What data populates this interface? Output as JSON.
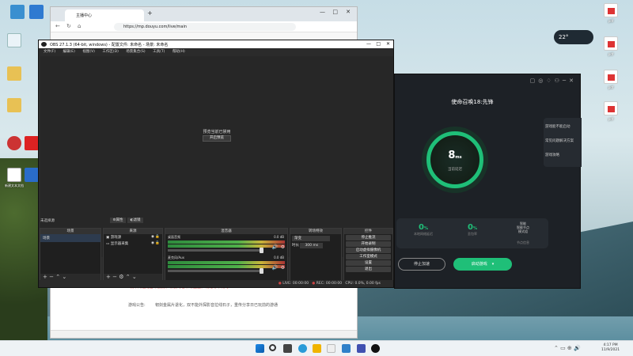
{
  "weather": {
    "temp": "22",
    "unit": "°"
  },
  "browser": {
    "tab_title": "主播中心",
    "url": "https://mp.douyu.com/live/main",
    "content_label": "游戏公告:",
    "content_text": "韧剑金属片退化，双不能外探影音拉线石子，重传分享日已玩前的游通",
    "content_text_red": "发布同位是否以服务，标服时已补行上全，线路等不确时"
  },
  "accelerator": {
    "title": "使命召唤18:先锋",
    "ring_value": "8",
    "ring_unit": "ms",
    "ring_caption": "当前延迟",
    "side_items": [
      "游戏能不能启动",
      "常见问题解决方案",
      "游戏攻略"
    ],
    "stats": [
      {
        "value": "0",
        "unit": "%",
        "label": "本地网络延迟"
      },
      {
        "value": "0",
        "unit": "%",
        "label": "丢包率"
      },
      {
        "value": "智能\n智能节点\n模式组",
        "unit": "",
        "label": "节点信息"
      }
    ],
    "stop_button": "停止加速",
    "start_button": "启动游戏"
  },
  "obs": {
    "title": "OBS 27.1.3 (64-bit, windows) - 配置文件: 未命名 - 场景: 未命名",
    "menu": [
      "文件(F)",
      "编辑(E)",
      "视图(V)",
      "工作区(D)",
      "场景集合(S)",
      "工具(T)",
      "帮助(H)"
    ],
    "preview_msg": "预览当前已禁用",
    "preview_btn": "开启预览",
    "no_source": "未选择源",
    "props_btn": "属性",
    "filter_btn": "滤镜",
    "docks": {
      "scenes": {
        "title": "场景",
        "items": [
          "场景"
        ]
      },
      "sources": {
        "title": "来源",
        "items": [
          "游戏源",
          "显示器采集"
        ]
      },
      "mixer": {
        "title": "混音器",
        "tracks": [
          {
            "name": "桌面音频",
            "db": "0.0 dB"
          },
          {
            "name": "麦克风/Aux",
            "db": "0.0 dB"
          }
        ]
      },
      "transitions": {
        "title": "转场特效",
        "type": "渐变",
        "duration_label": "时长",
        "duration": "300 ms"
      },
      "controls": {
        "title": "控件",
        "buttons": [
          "停止推流",
          "开始录制",
          "启动虚拟摄像机",
          "工作室模式",
          "设置",
          "退出"
        ]
      }
    },
    "status": {
      "live": "LIVE: 00:00:00",
      "rec": "REC: 00:00:00",
      "cpu": "CPU: 0.0%, 0.00 fps"
    }
  },
  "taskbar": {
    "time": "4:17 PM",
    "date": "11/9/2021"
  },
  "desktop_files": [
    "新建文本文档",
    "pdf",
    "pdf",
    "pdf",
    "pdf"
  ]
}
